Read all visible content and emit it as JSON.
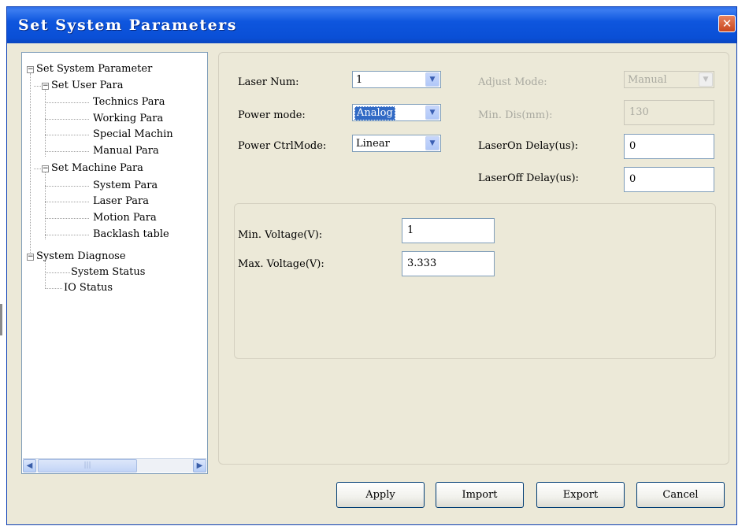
{
  "window": {
    "title": "Set System Parameters",
    "close_glyph": "✕"
  },
  "tree": {
    "root": "Set System Parameter",
    "user_para": "Set User Para",
    "technics": "Technics Para",
    "working": "Working Para",
    "special": "Special Machin",
    "manual": "Manual Para",
    "machine_para": "Set Machine Para",
    "system_para": "System Para",
    "laser_para": "Laser Para",
    "motion_para": "Motion Para",
    "backlash": "Backlash table",
    "diagnose": "System Diagnose",
    "system_status": "System Status",
    "io_status": "IO Status",
    "expander_glyph": "−",
    "scroll_left_glyph": "◀",
    "scroll_right_glyph": "▶",
    "scroll_grip": "|||"
  },
  "form": {
    "laser_num_label": "Laser Num:",
    "laser_num_value": "1",
    "power_mode_label": "Power mode:",
    "power_mode_value": "Analog",
    "power_ctrl_label": "Power CtrlMode:",
    "power_ctrl_value": "Linear",
    "adjust_mode_label": "Adjust Mode:",
    "adjust_mode_value": "Manual",
    "min_dis_label": "Min. Dis(mm):",
    "min_dis_value": "130",
    "laser_on_label": "LaserOn Delay(us):",
    "laser_on_value": "0",
    "laser_off_label": "LaserOff Delay(us):",
    "laser_off_value": "0",
    "min_voltage_label": "Min. Voltage(V):",
    "min_voltage_value": "1",
    "max_voltage_label": "Max. Voltage(V):",
    "max_voltage_value": "3.333",
    "arrow_glyph": "▼"
  },
  "buttons": {
    "apply": "Apply",
    "import": "Import",
    "export": "Export",
    "cancel": "Cancel"
  },
  "icons": {
    "close": "close-icon",
    "expander": "collapse-icon",
    "dropdown": "chevron-down-icon",
    "scroll_left": "arrow-left-icon",
    "scroll_right": "arrow-right-icon"
  },
  "colors": {
    "titlebar": "#0a4fd6",
    "close_button": "#d4562e",
    "dialog_bg": "#ece9d8",
    "selection": "#316ac5",
    "disabled_text": "#a9a9a0"
  }
}
